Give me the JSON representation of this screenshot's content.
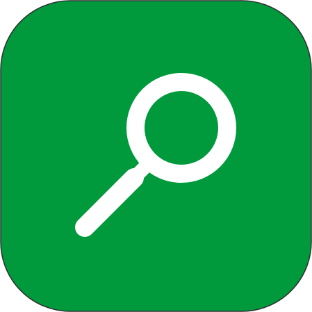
{
  "app_icon": {
    "icon": "search-icon",
    "colors": {
      "background": "#009A3C",
      "glyph": "#FFFFFF",
      "border": "#2E2E2E"
    }
  }
}
